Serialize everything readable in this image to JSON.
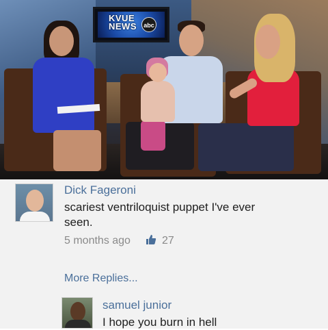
{
  "video": {
    "monitor_logo": "KVUE NEWS",
    "monitor_network": "abc"
  },
  "comments": [
    {
      "author": "Dick Fageroni",
      "text_line1": "scariest ventriloquist puppet I've ever",
      "text_line2": "seen.",
      "time": "5 months ago",
      "likes": "27"
    }
  ],
  "more_replies_label": "More Replies...",
  "reply": {
    "author": "samuel junior",
    "text": "I hope you burn in hell"
  },
  "icons": {
    "like": "thumbs-up-icon"
  },
  "colors": {
    "link": "#4a6f9a",
    "comment_bg": "#f2f2f2",
    "text": "#1e1e1e",
    "meta": "#8a8a8a"
  }
}
